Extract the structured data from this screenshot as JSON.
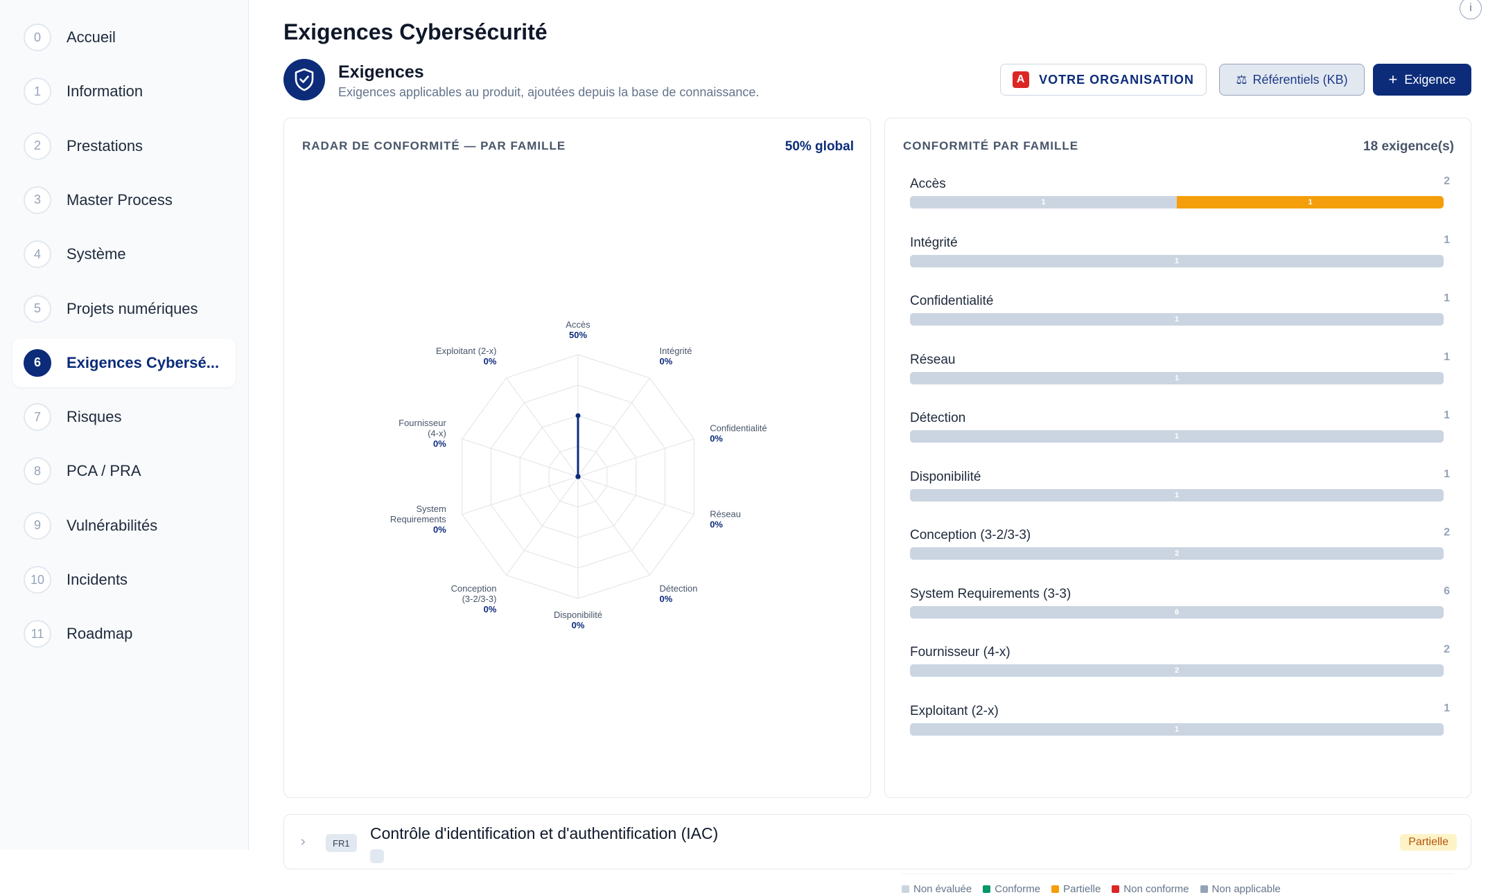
{
  "sidebar": {
    "items": [
      {
        "num": "0",
        "label": "Accueil"
      },
      {
        "num": "1",
        "label": "Information"
      },
      {
        "num": "2",
        "label": "Prestations"
      },
      {
        "num": "3",
        "label": "Master Process"
      },
      {
        "num": "4",
        "label": "Système"
      },
      {
        "num": "5",
        "label": "Projets numériques"
      },
      {
        "num": "6",
        "label": "Exigences Cybersé..."
      },
      {
        "num": "7",
        "label": "Risques"
      },
      {
        "num": "8",
        "label": "PCA / PRA"
      },
      {
        "num": "9",
        "label": "Vulnérabilités"
      },
      {
        "num": "10",
        "label": "Incidents"
      },
      {
        "num": "11",
        "label": "Roadmap"
      }
    ],
    "active_index": 6
  },
  "page": {
    "title": "Exigences Cybersécurité",
    "section_title": "Exigences",
    "section_subtitle": "Exigences applicables au produit, ajoutées depuis la base de connaissance."
  },
  "toolbar": {
    "org_badge": "A",
    "org_label": "VOTRE ORGANISATION",
    "kb_icon": "⚖",
    "kb_label": "Référentiels (KB)",
    "add_icon": "+",
    "add_label": "Exigence"
  },
  "radar": {
    "heading": "RADAR DE CONFORMITÉ — PAR FAMILLE",
    "global": "50% global"
  },
  "families_panel": {
    "heading": "CONFORMITÉ PAR FAMILLE",
    "total": "18 exigence(s)"
  },
  "chart_data": {
    "type": "radar",
    "axes": [
      {
        "label": [
          "Accès"
        ],
        "value": 50,
        "value_text": "50%"
      },
      {
        "label": [
          "Intégrité"
        ],
        "value": 0,
        "value_text": "0%"
      },
      {
        "label": [
          "Confidentialité"
        ],
        "value": 0,
        "value_text": "0%"
      },
      {
        "label": [
          "Réseau"
        ],
        "value": 0,
        "value_text": "0%"
      },
      {
        "label": [
          "Détection"
        ],
        "value": 0,
        "value_text": "0%"
      },
      {
        "label": [
          "Disponibilité"
        ],
        "value": 0,
        "value_text": "0%"
      },
      {
        "label": [
          "Conception",
          "(3-2/3-3)"
        ],
        "value": 0,
        "value_text": "0%"
      },
      {
        "label": [
          "System",
          "Requirements"
        ],
        "value": 0,
        "value_text": "0%"
      },
      {
        "label": [
          "Fournisseur",
          "(4-x)"
        ],
        "value": 0,
        "value_text": "0%"
      },
      {
        "label": [
          "Exploitant (2-x)"
        ],
        "value": 0,
        "value_text": "0%"
      }
    ],
    "range": [
      0,
      100
    ],
    "families": [
      {
        "name": "Accès",
        "total": "2",
        "segments": [
          {
            "status": "non_evaluee",
            "count": 1
          },
          {
            "status": "partielle",
            "count": 1
          }
        ]
      },
      {
        "name": "Intégrité",
        "total": "1",
        "segments": [
          {
            "status": "non_evaluee",
            "count": 1
          }
        ]
      },
      {
        "name": "Confidentialité",
        "total": "1",
        "segments": [
          {
            "status": "non_evaluee",
            "count": 1
          }
        ]
      },
      {
        "name": "Réseau",
        "total": "1",
        "segments": [
          {
            "status": "non_evaluee",
            "count": 1
          }
        ]
      },
      {
        "name": "Détection",
        "total": "1",
        "segments": [
          {
            "status": "non_evaluee",
            "count": 1
          }
        ]
      },
      {
        "name": "Disponibilité",
        "total": "1",
        "segments": [
          {
            "status": "non_evaluee",
            "count": 1
          }
        ]
      },
      {
        "name": "Conception (3-2/3-3)",
        "total": "2",
        "segments": [
          {
            "status": "non_evaluee",
            "count": 2
          }
        ]
      },
      {
        "name": "System Requirements (3-3)",
        "total": "6",
        "segments": [
          {
            "status": "non_evaluee",
            "count": 6
          }
        ]
      },
      {
        "name": "Fournisseur (4-x)",
        "total": "2",
        "segments": [
          {
            "status": "non_evaluee",
            "count": 2
          }
        ]
      },
      {
        "name": "Exploitant (2-x)",
        "total": "1",
        "segments": [
          {
            "status": "non_evaluee",
            "count": 1
          }
        ]
      }
    ],
    "legend": [
      {
        "key": "non_evaluee",
        "label": "Non évaluée",
        "color": "#cbd5e1"
      },
      {
        "key": "conforme",
        "label": "Conforme",
        "color": "#059669"
      },
      {
        "key": "partielle",
        "label": "Partielle",
        "color": "#f59e0b"
      },
      {
        "key": "non_conforme",
        "label": "Non conforme",
        "color": "#dc2626"
      },
      {
        "key": "non_applicable",
        "label": "Non applicable",
        "color": "#94a3b8"
      }
    ]
  },
  "requirement": {
    "tag": "FR1",
    "title": "Contrôle d'identification et d'authentification (IAC)",
    "status": "Partielle"
  },
  "colors": {
    "primary": "#0c2c7a",
    "partielle": "#f59e0b",
    "non_evaluee": "#cbd5e1"
  }
}
